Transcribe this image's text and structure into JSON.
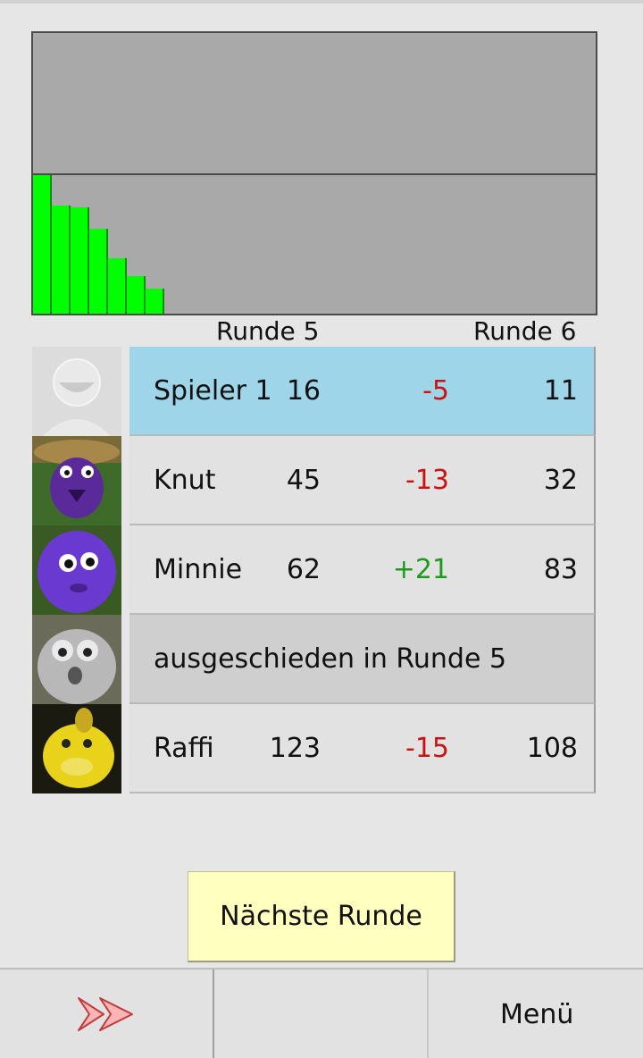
{
  "chart": {
    "bars": [
      0.988,
      0.772,
      0.76,
      0.608,
      0.392,
      0.266,
      0.177
    ],
    "bar_color": "#00ff00",
    "background": "#a9a9a9"
  },
  "rounds": {
    "left": "Runde 5",
    "right": "Runde 6"
  },
  "players": [
    {
      "name": "Spieler 1",
      "score": "16",
      "delta": "-5",
      "total": "11",
      "state": "highlight"
    },
    {
      "name": "Knut",
      "score": "45",
      "delta": "-13",
      "total": "32",
      "state": "normal"
    },
    {
      "name": "Minnie",
      "score": "62",
      "delta": "+21",
      "total": "83",
      "state": "normal"
    },
    {
      "eliminated_text": "ausgeschieden in Runde 5",
      "state": "eliminated"
    },
    {
      "name": "Raffi",
      "score": "123",
      "delta": "-15",
      "total": "108",
      "state": "normal"
    }
  ],
  "next_button": "Nächste Runde",
  "bottom": {
    "menu": "Menü",
    "forward_icon": "fast-forward-icon"
  }
}
